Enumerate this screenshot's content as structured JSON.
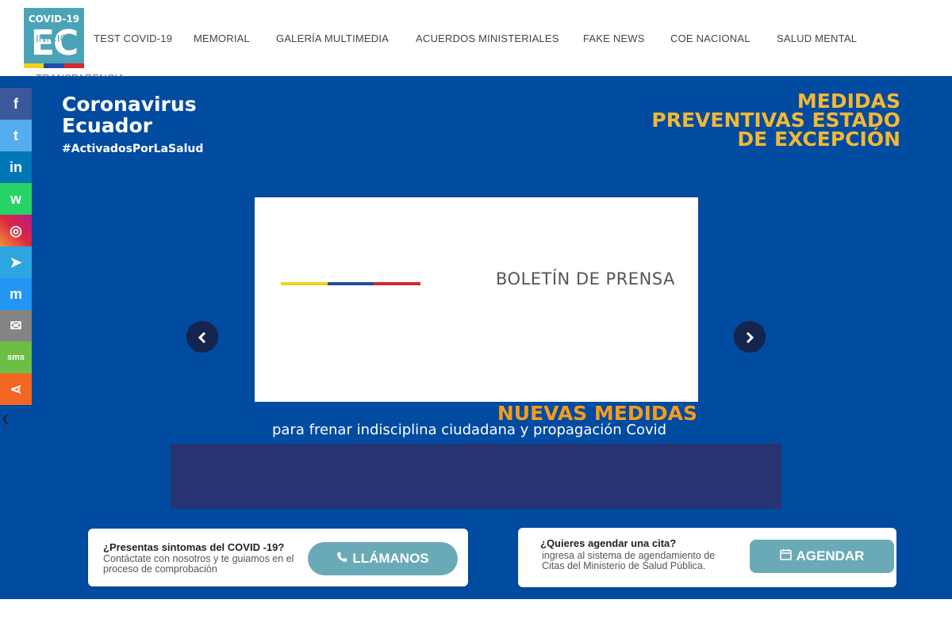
{
  "logo": {
    "line1": "COVID-19",
    "line2": "EC",
    "stripe_colors": [
      "#f3d11a",
      "#1f4fa0",
      "#d8282f"
    ]
  },
  "nav": {
    "items": [
      "INICIO",
      "TEST COVID-19",
      "MEMORIAL",
      "GALERÍA MULTIMEDIA",
      "ACUERDOS MINISTERIALES",
      "FAKE NEWS",
      "COE NACIONAL",
      "SALUD MENTAL",
      "TRANSPARENCIA"
    ]
  },
  "brand": {
    "line1": "Coronavirus",
    "line2": "Ecuador",
    "hashtag": "#ActivadosPorLaSalud"
  },
  "medidas": {
    "line1": "MEDIDAS",
    "line2": "PREVENTIVAS ESTADO",
    "line3": "DE EXCEPCIÓN"
  },
  "slide": {
    "title": "BOLETÍN DE PRENSA",
    "flag_colors": [
      "#f3d11a",
      "#1f4fa0",
      "#d8282f"
    ]
  },
  "carousel": {
    "prev": "‹",
    "next": "›"
  },
  "headline": {
    "title": "NUEVAS MEDIDAS",
    "subtitle": "para frenar indisciplina ciudadana y propagación Covid"
  },
  "cards": [
    {
      "question": "¿Presentas sintomas del COVID -19?",
      "description": "Contáctate con nosotros y te guiamos en el proceso de comprobación",
      "button": "LLÁMANOS",
      "icon": "phone-icon"
    },
    {
      "question": "¿Quieres agendar una cita?",
      "description": "ingresa al sistema de agendamiento de Citas del Ministerio de Salud Pública.",
      "button": "AGENDAR",
      "icon": "calendar-icon"
    }
  ],
  "social": [
    {
      "name": "facebook",
      "glyph": "f",
      "color": "#3b5998"
    },
    {
      "name": "twitter",
      "glyph": "t",
      "color": "#55acee"
    },
    {
      "name": "linkedin",
      "glyph": "in",
      "color": "#0077b5"
    },
    {
      "name": "whatsapp",
      "glyph": "w",
      "color": "#25d366"
    },
    {
      "name": "instagram",
      "glyph": "◎",
      "color": "#c13584"
    },
    {
      "name": "telegram",
      "glyph": "➤",
      "color": "#2ca5e0"
    },
    {
      "name": "messenger",
      "glyph": "m",
      "color": "#2196f3"
    },
    {
      "name": "email",
      "glyph": "✉",
      "color": "#848484"
    },
    {
      "name": "sms",
      "glyph": "sms",
      "color": "#6cbe45"
    },
    {
      "name": "share",
      "glyph": "⋖",
      "color": "#f26522"
    }
  ],
  "hide_tab": "❮",
  "colors": {
    "hero_bg": "#014ba1",
    "accent_yellow": "#f3b833",
    "accent_orange": "#f59c1a",
    "panel": "#283371",
    "button": "#6aaab6"
  }
}
